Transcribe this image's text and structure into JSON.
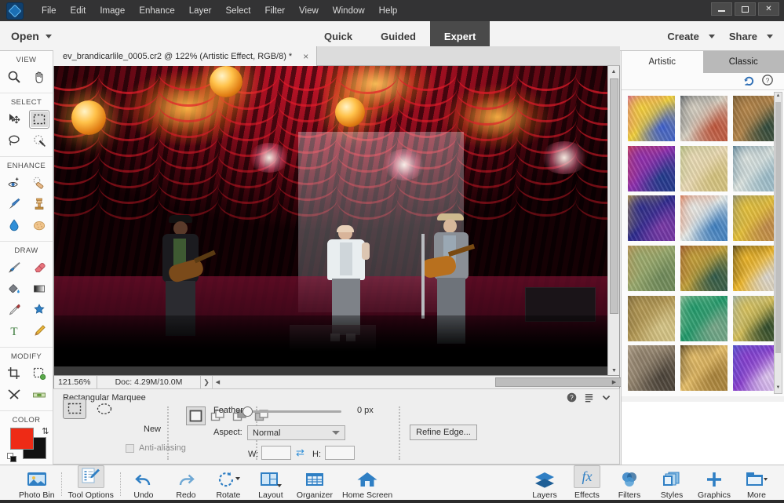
{
  "window": {
    "app_logo": "photoshop-elements-logo",
    "controls": {
      "minimize": "–",
      "maximize": "□",
      "close": "✕"
    }
  },
  "menubar": {
    "items": [
      "File",
      "Edit",
      "Image",
      "Enhance",
      "Layer",
      "Select",
      "Filter",
      "View",
      "Window",
      "Help"
    ]
  },
  "modebar": {
    "open_label": "Open",
    "modes": [
      {
        "label": "Quick",
        "active": false
      },
      {
        "label": "Guided",
        "active": false
      },
      {
        "label": "Expert",
        "active": true
      }
    ],
    "create_label": "Create",
    "share_label": "Share"
  },
  "document": {
    "tab_title": "ev_brandicarlile_0005.cr2 @ 122% (Artistic Effect, RGB/8) *",
    "close_label": "×"
  },
  "toolbox": {
    "groups": [
      {
        "title": "VIEW",
        "tools": [
          "zoom-tool",
          "hand-tool"
        ]
      },
      {
        "title": "SELECT",
        "tools": [
          "move-tool",
          "rectangular-marquee-tool",
          "lasso-tool",
          "quick-selection-tool"
        ]
      },
      {
        "title": "ENHANCE",
        "tools": [
          "red-eye-removal-tool",
          "spot-healing-brush-tool",
          "smart-brush-tool",
          "clone-stamp-tool",
          "blur-tool",
          "sponge-tool"
        ]
      },
      {
        "title": "DRAW",
        "tools": [
          "brush-tool",
          "eraser-tool",
          "paint-bucket-tool",
          "gradient-tool",
          "color-picker-tool",
          "custom-shape-tool",
          "type-tool",
          "pencil-tool"
        ]
      },
      {
        "title": "MODIFY",
        "tools": [
          "crop-tool",
          "recompose-tool",
          "content-aware-move-tool",
          "straighten-tool"
        ]
      }
    ],
    "color_title": "COLOR",
    "foreground_color": "#ee2b16",
    "background_color": "#111111"
  },
  "statusbar": {
    "zoom": "121.56%",
    "doc_info": "Doc: 4.29M/10.0M"
  },
  "tool_options": {
    "title": "Rectangular Marquee",
    "marquee_shapes": [
      "rectangular-marquee",
      "elliptical-marquee"
    ],
    "selection_modes": [
      "new-selection",
      "add-to-selection",
      "subtract-from-selection",
      "intersect-with-selection"
    ],
    "mode_label": "New",
    "antialiasing_label": "Anti-aliasing",
    "antialiasing_checked": false,
    "feather_label": "Feather:",
    "feather_value": "0 px",
    "aspect_label": "Aspect:",
    "aspect_value": "Normal",
    "width_label": "W:",
    "width_value": "",
    "height_label": "H:",
    "height_value": "",
    "refine_edge_label": "Refine Edge...",
    "icons": [
      "help-icon",
      "options-menu-icon",
      "collapse-chevron-icon"
    ]
  },
  "right_panel": {
    "tabs": [
      {
        "label": "Artistic",
        "active": false
      },
      {
        "label": "Classic",
        "active": true
      }
    ],
    "tool_icons": [
      "undo-history-icon",
      "help-icon"
    ],
    "effects": [
      {
        "name": "pop-art-face",
        "c1": "#f4d23b",
        "c2": "#d54ea8",
        "c3": "#3c5fd0"
      },
      {
        "name": "abstract-cubist",
        "c1": "#d9d2c4",
        "c2": "#2e3a46",
        "c3": "#c0553a"
      },
      {
        "name": "mona-lisa",
        "c1": "#b8884c",
        "c2": "#5d4a2a",
        "c3": "#2f4a3c"
      },
      {
        "name": "expressive-portrait",
        "c1": "#8e2fb0",
        "c2": "#e0473f",
        "c3": "#1e3c8c"
      },
      {
        "name": "pastel-landscape",
        "c1": "#ecdcb8",
        "c2": "#9fb36a",
        "c3": "#d4c27c"
      },
      {
        "name": "great-wave",
        "c1": "#dfe6e2",
        "c2": "#2b5f7e",
        "c3": "#9bbcc9"
      },
      {
        "name": "blue-figures",
        "c1": "#2b2a8e",
        "c2": "#e8c23a",
        "c3": "#7c39a8"
      },
      {
        "name": "colorful-dog",
        "c1": "#e8ece9",
        "c2": "#e05a2b",
        "c3": "#3e7fc0"
      },
      {
        "name": "van-gogh-self-portrait",
        "c1": "#e8c33a",
        "c2": "#6e7f8c",
        "c3": "#c08a4a"
      },
      {
        "name": "olive-trees",
        "c1": "#9aab6e",
        "c2": "#c88a4a",
        "c3": "#6f8a5a"
      },
      {
        "name": "bedroom-in-arles",
        "c1": "#c4a23a",
        "c2": "#8e3a2a",
        "c3": "#2f5a4a"
      },
      {
        "name": "yellow-abstract",
        "c1": "#f0b82a",
        "c2": "#1a1a1a",
        "c3": "#dcd8d2"
      },
      {
        "name": "brown-texture",
        "c1": "#b59a55",
        "c2": "#6e5a32",
        "c3": "#d8c88a"
      },
      {
        "name": "green-swirl",
        "c1": "#1f9a6a",
        "c2": "#cbd4b2",
        "c3": "#7aa88a"
      },
      {
        "name": "wheatfield-cypress",
        "c1": "#d9c25a",
        "c2": "#8fb0cc",
        "c3": "#2e4a2a"
      },
      {
        "name": "group-photo",
        "c1": "#8e7f6a",
        "c2": "#c9b8a0",
        "c3": "#4a4238"
      },
      {
        "name": "concert-stage",
        "c1": "#e8c06a",
        "c2": "#1a1208",
        "c3": "#a8823a"
      },
      {
        "name": "purple-fluid",
        "c1": "#8a3fd0",
        "c2": "#3f5fd0",
        "c3": "#e0c8f0"
      }
    ]
  },
  "taskbar": {
    "left_items": [
      {
        "label": "Photo Bin",
        "icon": "photo-bin-icon",
        "selected": false,
        "has_caret": false
      },
      {
        "label": "Tool Options",
        "icon": "tool-options-icon",
        "selected": true,
        "has_caret": false
      },
      {
        "label": "Undo",
        "icon": "undo-icon",
        "selected": false,
        "has_caret": false
      },
      {
        "label": "Redo",
        "icon": "redo-icon",
        "selected": false,
        "has_caret": false
      },
      {
        "label": "Rotate",
        "icon": "rotate-icon",
        "selected": false,
        "has_caret": true
      },
      {
        "label": "Layout",
        "icon": "layout-icon",
        "selected": false,
        "has_caret": true
      },
      {
        "label": "Organizer",
        "icon": "organizer-icon",
        "selected": false,
        "has_caret": false
      },
      {
        "label": "Home Screen",
        "icon": "home-screen-icon",
        "selected": false,
        "has_caret": false
      }
    ],
    "right_items": [
      {
        "label": "Layers",
        "icon": "layers-icon",
        "selected": false,
        "has_caret": false
      },
      {
        "label": "Effects",
        "icon": "effects-fx-icon",
        "selected": true,
        "has_caret": false
      },
      {
        "label": "Filters",
        "icon": "filters-icon",
        "selected": false,
        "has_caret": false
      },
      {
        "label": "Styles",
        "icon": "styles-icon",
        "selected": false,
        "has_caret": false
      },
      {
        "label": "Graphics",
        "icon": "graphics-plus-icon",
        "selected": false,
        "has_caret": false
      },
      {
        "label": "More",
        "icon": "more-icon",
        "selected": false,
        "has_caret": true
      }
    ]
  },
  "colors": {
    "titlebar_bg": "#333334",
    "accent_blue": "#2f7fc4",
    "active_mode_bg": "#4a4a4a",
    "panel_bg": "#f1f1f1"
  }
}
